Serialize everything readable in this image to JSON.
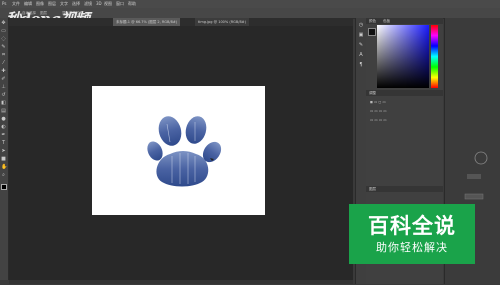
{
  "watermark": {
    "text": "秒dong视频"
  },
  "menubar": {
    "items": [
      "文件",
      "编辑",
      "图像",
      "图层",
      "文字",
      "选择",
      "滤镜",
      "3D",
      "视图",
      "窗口",
      "帮助"
    ]
  },
  "optionsbar": {
    "items": [
      "自动选择",
      "图层",
      "显示变换控件"
    ]
  },
  "tabs": [
    {
      "label": "未标题-1 @ 66.7% (图层 2, RGB/8#)"
    },
    {
      "label": "timg.jpg @ 100% (RGB/8#)"
    }
  ],
  "toolbar": {
    "tools": [
      "move",
      "marquee",
      "lasso",
      "quick-select",
      "crop",
      "eyedropper",
      "healing",
      "brush",
      "stamp",
      "history-brush",
      "eraser",
      "gradient",
      "blur",
      "dodge",
      "pen",
      "type",
      "path-select",
      "shape",
      "hand",
      "zoom"
    ]
  },
  "canvas": {
    "background": "#ffffff",
    "artwork": "paw-print"
  },
  "panels": {
    "color_tab": "颜色",
    "swatches_tab": "色板",
    "adjust_tab": "调整",
    "layers_tab": "图层"
  },
  "badge": {
    "title": "百科全说",
    "subtitle": "助你轻松解决",
    "color": "#1aa34a"
  },
  "colors": {
    "workspace": "#282828",
    "panel": "#404040",
    "accent_green": "#1aa34a"
  }
}
